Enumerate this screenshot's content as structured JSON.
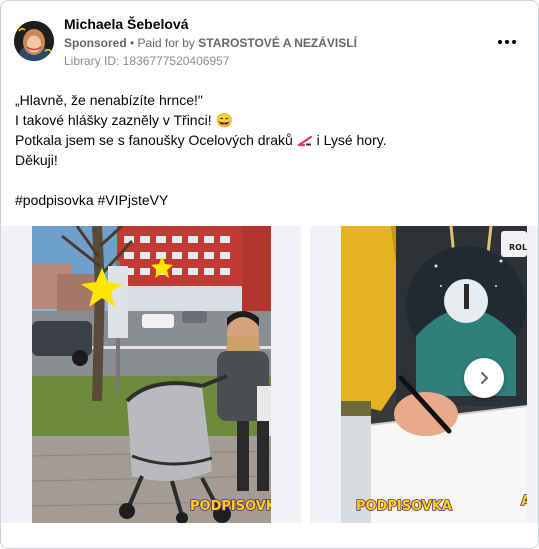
{
  "post": {
    "author": "Michaela Šebelová",
    "sponsored_label": "Sponsored",
    "paid_for_prefix": " • Paid for by ",
    "payer": "STAROSTOVÉ A NEZÁVISLÍ",
    "library_id": "Library ID: 1836777520406957",
    "more_icon": "more-horizontal-icon"
  },
  "body": {
    "line1": "„Hlavně, že nenabízíte hrnce!\"",
    "line2": "I takové hlášky zazněly v Třinci! 😄",
    "line3_before": "Potkala jsem se s fanoušky Ocelových draků ",
    "line3_after": " i Lysé hory.",
    "line4": "Děkuji!",
    "hashtags": "#podpisovka #VIPjsteVY"
  },
  "carousel": {
    "slide1_sticker": "PODPISOVKA",
    "slide2_sticker": "PODPISOVKA",
    "slide2_cap": "ROL",
    "next_icon": "chevron-right-icon"
  }
}
